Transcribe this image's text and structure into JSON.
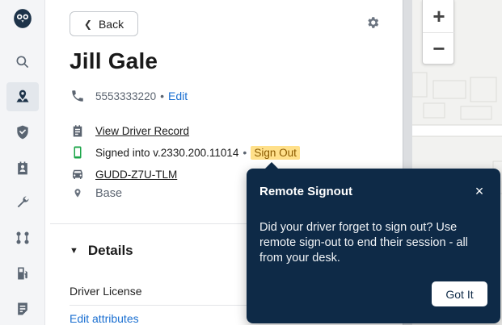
{
  "header": {
    "back_label": "Back",
    "settings_icon": "gear-icon"
  },
  "driver": {
    "name": "Jill Gale",
    "phone": "5553333220",
    "phone_separator": "•",
    "phone_edit_label": "Edit",
    "view_record_label": "View Driver Record",
    "signed_in_text": "Signed into v.2330.200.11014",
    "signed_in_separator": "•",
    "sign_out_label": "Sign Out",
    "vehicle": "GUDD-Z7U-TLM",
    "location": "Base"
  },
  "details": {
    "heading": "Details",
    "license_label": "Driver License",
    "edit_attributes_label": "Edit attributes"
  },
  "map": {
    "zoom_in": "+",
    "zoom_out": "−"
  },
  "popover": {
    "title": "Remote Signout",
    "close": "×",
    "body": "Did your driver forget to sign out? Use remote sign-out to end their session - all from your desk.",
    "button_label": "Got It"
  },
  "sidebar": {
    "items": [
      {
        "icon": "owl-logo-icon"
      },
      {
        "icon": "search-icon"
      },
      {
        "icon": "map-pin-person-icon",
        "active": true
      },
      {
        "icon": "shield-check-icon"
      },
      {
        "icon": "clipboard-person-icon"
      },
      {
        "icon": "wrench-icon"
      },
      {
        "icon": "route-icon"
      },
      {
        "icon": "fuel-icon"
      },
      {
        "icon": "document-edit-icon"
      }
    ]
  },
  "colors": {
    "accent_link": "#1a6fd1",
    "popover_bg": "#0e2a47",
    "highlight": "#ffe08a",
    "signed_in_green": "#1ba548"
  }
}
